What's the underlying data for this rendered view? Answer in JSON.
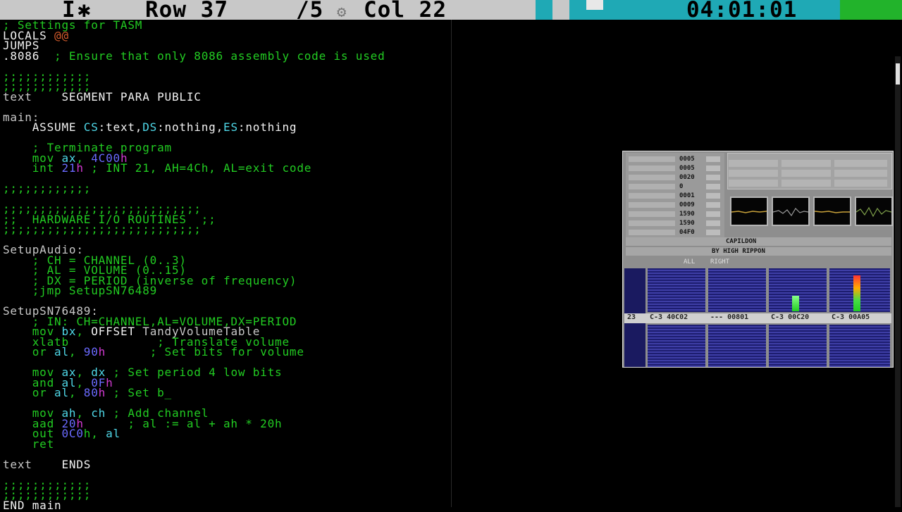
{
  "statusbar": {
    "mode": "I",
    "mode_icon": "asterisk-icon",
    "row_label": "Row 37",
    "total": "/5",
    "col_label": "Col 22",
    "clock": "04:01:01",
    "colors": {
      "bar": "#c8c8c8",
      "cyan": "#1fa9b5",
      "green": "#22b32b"
    }
  },
  "editor": {
    "lines": [
      [
        {
          "t": "; Settings for TASM",
          "c": "green"
        }
      ],
      [
        {
          "t": "LOCALS ",
          "c": "white"
        },
        {
          "t": "@@",
          "c": "orange"
        }
      ],
      [
        {
          "t": "JUMPS",
          "c": "white"
        }
      ],
      [
        {
          "t": ".8086",
          "c": "white"
        },
        {
          "t": "  ; Ensure that only 8086 assembly code is used",
          "c": "green"
        }
      ],
      [],
      [
        {
          "t": ";;;;;;;;;;;;",
          "c": "green"
        }
      ],
      [
        {
          "t": ";;;;;;;;;;;;",
          "c": "green"
        }
      ],
      [
        {
          "t": "text",
          "c": "grey"
        },
        {
          "t": "    SEGMENT PARA PUBLIC",
          "c": "white"
        }
      ],
      [],
      [
        {
          "t": "main:",
          "c": "grey"
        }
      ],
      [
        {
          "t": "    ASSUME ",
          "c": "white"
        },
        {
          "t": "CS",
          "c": "cyan"
        },
        {
          "t": ":text,",
          "c": "white"
        },
        {
          "t": "DS",
          "c": "cyan"
        },
        {
          "t": ":nothing,",
          "c": "white"
        },
        {
          "t": "ES",
          "c": "cyan"
        },
        {
          "t": ":nothing",
          "c": "white"
        }
      ],
      [],
      [
        {
          "t": "    ; Terminate program",
          "c": "green"
        }
      ],
      [
        {
          "t": "    mov ",
          "c": "green"
        },
        {
          "t": "ax",
          "c": "cyan"
        },
        {
          "t": ", ",
          "c": "green"
        },
        {
          "t": "4C00",
          "c": "blue"
        },
        {
          "t": "h",
          "c": "mag"
        }
      ],
      [
        {
          "t": "    int ",
          "c": "green"
        },
        {
          "t": "21",
          "c": "blue"
        },
        {
          "t": "h",
          "c": "mag"
        },
        {
          "t": " ; INT 21, AH=4Ch, AL=exit code",
          "c": "green"
        }
      ],
      [],
      [
        {
          "t": ";;;;;;;;;;;;",
          "c": "green"
        }
      ],
      [],
      [
        {
          "t": ";;;;;;;;;;;;;;;;;;;;;;;;;;;",
          "c": "green"
        }
      ],
      [
        {
          "t": ";;  HARDWARE I/O ROUTINES  ;;",
          "c": "green"
        }
      ],
      [
        {
          "t": ";;;;;;;;;;;;;;;;;;;;;;;;;;;",
          "c": "green"
        }
      ],
      [],
      [
        {
          "t": "SetupAudio:",
          "c": "grey"
        }
      ],
      [
        {
          "t": "    ; CH = CHANNEL (0..3)",
          "c": "green"
        }
      ],
      [
        {
          "t": "    ; AL = VOLUME (0..15)",
          "c": "green"
        }
      ],
      [
        {
          "t": "    ; DX = PERIOD (inverse of frequency)",
          "c": "green"
        }
      ],
      [
        {
          "t": "    ;jmp SetupSN76489",
          "c": "green"
        }
      ],
      [],
      [
        {
          "t": "SetupSN76489:",
          "c": "grey"
        }
      ],
      [
        {
          "t": "    ; IN: CH=CHANNEL,AL=VOLUME,DX=PERIOD",
          "c": "green"
        }
      ],
      [
        {
          "t": "    mov ",
          "c": "green"
        },
        {
          "t": "bx",
          "c": "cyan"
        },
        {
          "t": ", ",
          "c": "green"
        },
        {
          "t": "OFFSET",
          "c": "white"
        },
        {
          "t": " TandyVolumeTable",
          "c": "grey"
        }
      ],
      [
        {
          "t": "    xlatb            ; Translate volume",
          "c": "green"
        }
      ],
      [
        {
          "t": "    or ",
          "c": "green"
        },
        {
          "t": "al",
          "c": "cyan"
        },
        {
          "t": ", ",
          "c": "green"
        },
        {
          "t": "90",
          "c": "blue"
        },
        {
          "t": "h",
          "c": "mag"
        },
        {
          "t": "      ; Set bits for volume",
          "c": "green"
        }
      ],
      [],
      [
        {
          "t": "    mov ",
          "c": "green"
        },
        {
          "t": "ax",
          "c": "cyan"
        },
        {
          "t": ", ",
          "c": "green"
        },
        {
          "t": "dx",
          "c": "cyan"
        },
        {
          "t": " ; Set period 4 low bits",
          "c": "green"
        }
      ],
      [
        {
          "t": "    and ",
          "c": "green"
        },
        {
          "t": "al",
          "c": "cyan"
        },
        {
          "t": ", ",
          "c": "green"
        },
        {
          "t": "0F",
          "c": "blue"
        },
        {
          "t": "h",
          "c": "mag"
        }
      ],
      [
        {
          "t": "    or ",
          "c": "green"
        },
        {
          "t": "al",
          "c": "cyan"
        },
        {
          "t": ", ",
          "c": "green"
        },
        {
          "t": "80",
          "c": "blue"
        },
        {
          "t": "h",
          "c": "mag"
        },
        {
          "t": " ; Set b_",
          "c": "green"
        }
      ],
      [],
      [
        {
          "t": "    mov ",
          "c": "green"
        },
        {
          "t": "ah",
          "c": "cyan"
        },
        {
          "t": ", ",
          "c": "green"
        },
        {
          "t": "ch",
          "c": "cyan"
        },
        {
          "t": " ; Add channel",
          "c": "green"
        }
      ],
      [
        {
          "t": "    aad ",
          "c": "green"
        },
        {
          "t": "20",
          "c": "blue"
        },
        {
          "t": "h",
          "c": "mag"
        },
        {
          "t": "      ; al := al + ah * 20h",
          "c": "green"
        }
      ],
      [
        {
          "t": "    out ",
          "c": "green"
        },
        {
          "t": "0C0",
          "c": "blue"
        },
        {
          "t": "h, ",
          "c": "green"
        },
        {
          "t": "al",
          "c": "cyan"
        }
      ],
      [
        {
          "t": "    ret",
          "c": "green"
        }
      ],
      [],
      [
        {
          "t": "text",
          "c": "grey"
        },
        {
          "t": "    ENDS",
          "c": "white"
        }
      ],
      [],
      [
        {
          "t": ";;;;;;;;;;;;",
          "c": "green"
        }
      ],
      [
        {
          "t": ";;;;;;;;;;;;",
          "c": "green"
        }
      ],
      [
        {
          "t": "END main",
          "c": "white"
        }
      ]
    ]
  },
  "tracker": {
    "title": "CAPILDON",
    "author": "BY HIGH RIPPON",
    "labels": [
      "ALL",
      "RIGHT"
    ],
    "position_row": "23",
    "tracks": [
      "C-3 40C02",
      "--- 00801",
      "C-3 00C20",
      "C-3 00A05"
    ],
    "params": [
      "0005",
      "0005",
      "0020",
      "0",
      "0001",
      "0009",
      "1590",
      "1590",
      "04F0"
    ],
    "vu_levels": [
      0,
      0,
      0.35,
      0.85
    ],
    "scope_icons": [
      "oscilloscope-1",
      "oscilloscope-2",
      "oscilloscope-3",
      "oscilloscope-4"
    ]
  }
}
